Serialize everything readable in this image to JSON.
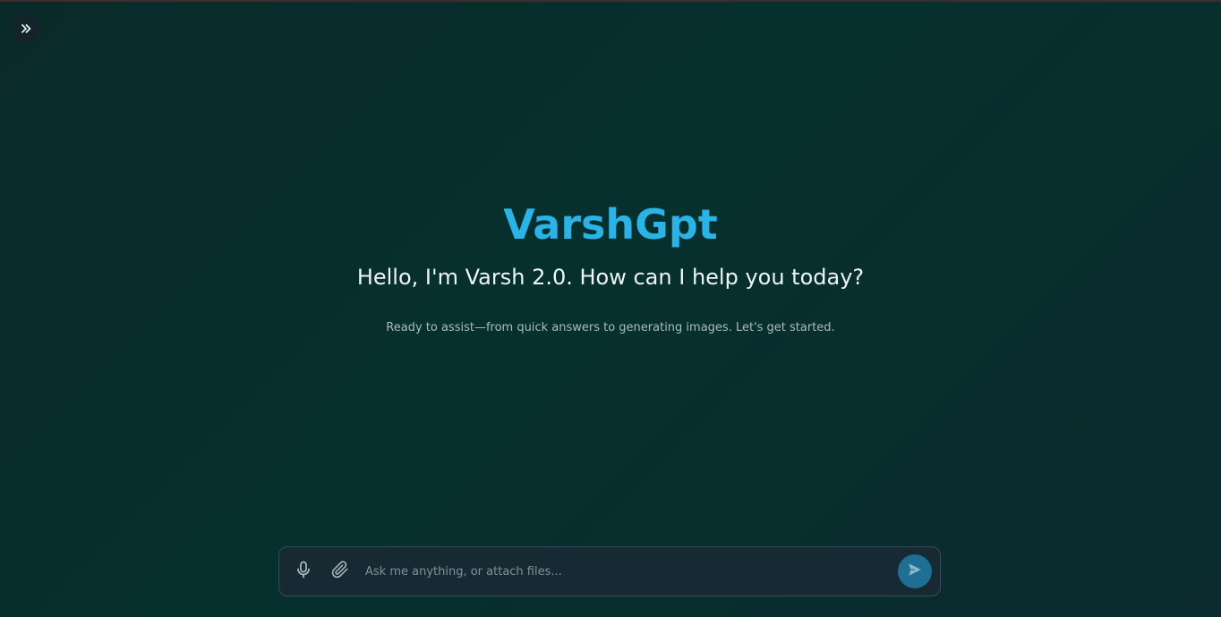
{
  "sidebar_toggle": {
    "icon": "double-chevron-right-icon"
  },
  "hero": {
    "brand": "VarshGpt",
    "greeting": "Hello, I'm Varsh 2.0. How can I help you today?",
    "tagline": "Ready to assist—from quick answers to generating images. Let's get started."
  },
  "composer": {
    "placeholder": "Ask me anything, or attach files...",
    "value": "",
    "mic_icon": "microphone-icon",
    "attach_icon": "paperclip-icon",
    "send_icon": "send-icon"
  },
  "colors": {
    "brand": "#29b3e6",
    "send_button": "#1e6f93",
    "background": "#06302e",
    "composer_bg": "#172a33"
  }
}
